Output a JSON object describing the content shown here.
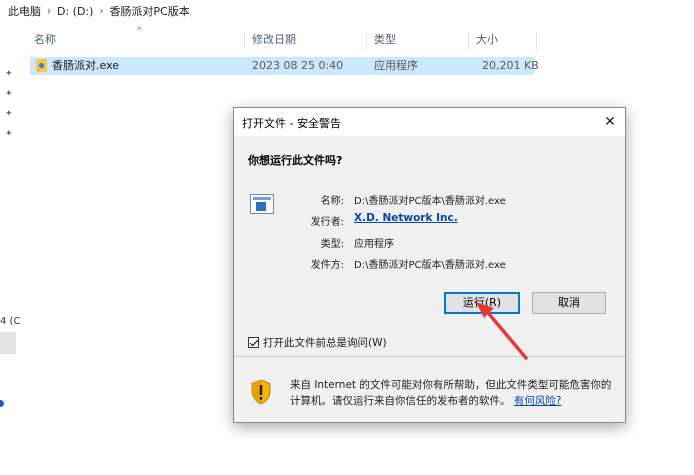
{
  "explorer": {
    "breadcrumb": [
      "此电脑",
      "D: (D:)",
      "香肠派对PC版本"
    ],
    "columns": {
      "name": "名称",
      "modified": "修改日期",
      "type": "类型",
      "size": "大小"
    },
    "file": {
      "name": "香肠派对.exe",
      "modified": "2023 08 25 0:40",
      "type": "应用程序",
      "size": "20,201 KB"
    },
    "left_fragment": "4 (C"
  },
  "dialog": {
    "title": "打开文件 - 安全警告",
    "close_symbol": "✕",
    "question": "你想运行此文件吗?",
    "fields": [
      {
        "label": "名称:",
        "value": "D:\\香肠派对PC版本\\香肠派对.exe"
      },
      {
        "label": "发行者:",
        "value": "X.D. Network Inc."
      },
      {
        "label": "类型:",
        "value": "应用程序"
      },
      {
        "label": "发件方:",
        "value": "D:\\香肠派对PC版本\\香肠派对.exe"
      }
    ],
    "run_label": "运行(R)",
    "cancel_label": "取消",
    "always_ask_label": "打开此文件前总是询问(W)",
    "always_ask_checked": true,
    "warning_text": "来自 Internet 的文件可能对你有所帮助，但此文件类型可能危害你的计算机。请仅运行来自你信任的发布者的软件。",
    "warning_link": "有何风险?"
  },
  "colors": {
    "selection": "#cce8ff",
    "link": "#0645ad",
    "accent": "#0078d7",
    "arrow": "#e53935"
  },
  "icons": {
    "app": "application-icon",
    "shield": "security-shield-icon",
    "pin": "pin-icon"
  }
}
